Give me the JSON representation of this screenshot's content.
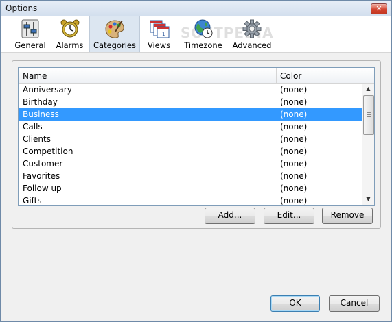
{
  "window": {
    "title": "Options",
    "close_glyph": "✕"
  },
  "toolbar": {
    "watermark": "SOFTPEDIA",
    "items": [
      {
        "label": "General",
        "icon": "general-settings-icon"
      },
      {
        "label": "Alarms",
        "icon": "alarm-clock-icon"
      },
      {
        "label": "Categories",
        "icon": "palette-icon",
        "active": true
      },
      {
        "label": "Views",
        "icon": "calendar-views-icon"
      },
      {
        "label": "Timezone",
        "icon": "globe-clock-icon"
      },
      {
        "label": "Advanced",
        "icon": "gear-icon"
      }
    ]
  },
  "categories": {
    "columns": {
      "name": "Name",
      "color": "Color"
    },
    "rows": [
      {
        "name": "Anniversary",
        "color": "(none)"
      },
      {
        "name": "Birthday",
        "color": "(none)"
      },
      {
        "name": "Business",
        "color": "(none)",
        "selected": true
      },
      {
        "name": "Calls",
        "color": "(none)"
      },
      {
        "name": "Clients",
        "color": "(none)"
      },
      {
        "name": "Competition",
        "color": "(none)"
      },
      {
        "name": "Customer",
        "color": "(none)"
      },
      {
        "name": "Favorites",
        "color": "(none)"
      },
      {
        "name": "Follow up",
        "color": "(none)"
      },
      {
        "name": "Gifts",
        "color": "(none)"
      }
    ],
    "buttons": {
      "add": {
        "mnemonic": "A",
        "rest": "dd..."
      },
      "edit": {
        "mnemonic": "E",
        "rest": "dit..."
      },
      "remove": {
        "mnemonic": "R",
        "rest": "emove"
      }
    }
  },
  "footer": {
    "ok": "OK",
    "cancel": "Cancel"
  },
  "colors": {
    "selection": "#3399ff",
    "active_tab": "#dce6f1"
  }
}
